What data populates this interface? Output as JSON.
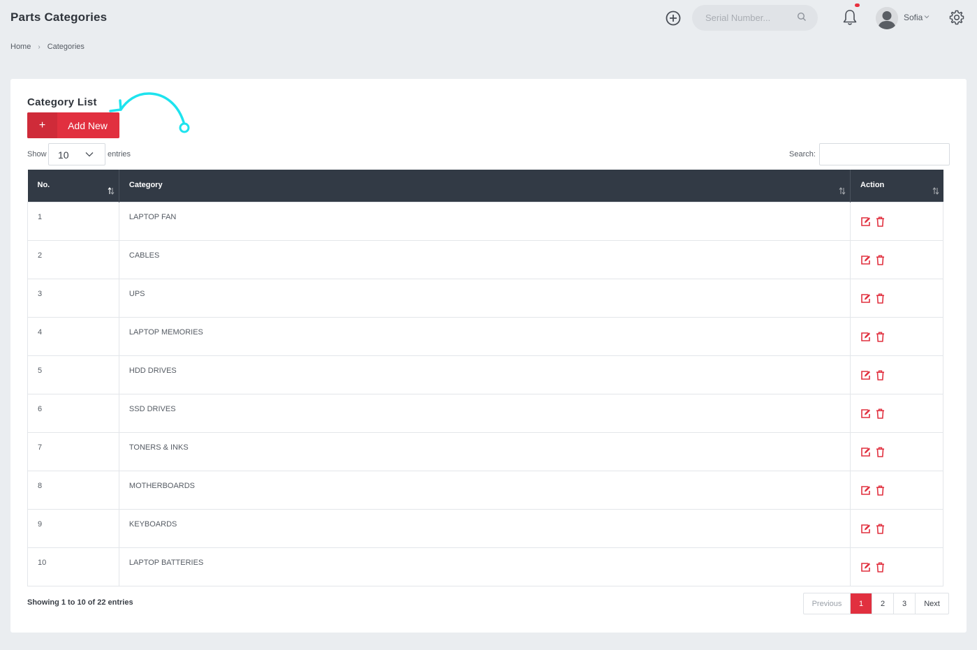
{
  "header": {
    "title": "Parts Categories",
    "serial_placeholder": "Serial Number...",
    "user_name": "Sofia",
    "icons": [
      "add-circle-icon",
      "search-icon",
      "bell-icon",
      "avatar",
      "chevron-down-icon",
      "gear-icon"
    ]
  },
  "breadcrumb": {
    "home": "Home",
    "separator": "›",
    "current": "Categories"
  },
  "card": {
    "title": "Category List",
    "add_plus": "+",
    "add_label": "Add New",
    "show_label": "Show",
    "length_value": "10",
    "entries_label": "entries",
    "search_label": "Search:",
    "search_value": ""
  },
  "table": {
    "headers": {
      "no": "No.",
      "category": "Category",
      "action": "Action"
    },
    "rows": [
      {
        "no": "1",
        "category": "LAPTOP FAN"
      },
      {
        "no": "2",
        "category": "CABLES"
      },
      {
        "no": "3",
        "category": "UPS"
      },
      {
        "no": "4",
        "category": "LAPTOP MEMORIES"
      },
      {
        "no": "5",
        "category": "HDD DRIVES"
      },
      {
        "no": "6",
        "category": "SSD DRIVES"
      },
      {
        "no": "7",
        "category": "TONERS & INKS"
      },
      {
        "no": "8",
        "category": "MOTHERBOARDS"
      },
      {
        "no": "9",
        "category": "KEYBOARDS"
      },
      {
        "no": "10",
        "category": "LAPTOP BATTERIES"
      }
    ]
  },
  "footer": {
    "info": "Showing 1 to 10 of 22 entries",
    "pagination": {
      "previous": "Previous",
      "pages": [
        "1",
        "2",
        "3"
      ],
      "active": "1",
      "next": "Next"
    }
  },
  "colors": {
    "accent": "#e1303f",
    "header_bg": "#323a45",
    "annotation": "#1ee3ee",
    "page_bg": "#eaedf0"
  }
}
